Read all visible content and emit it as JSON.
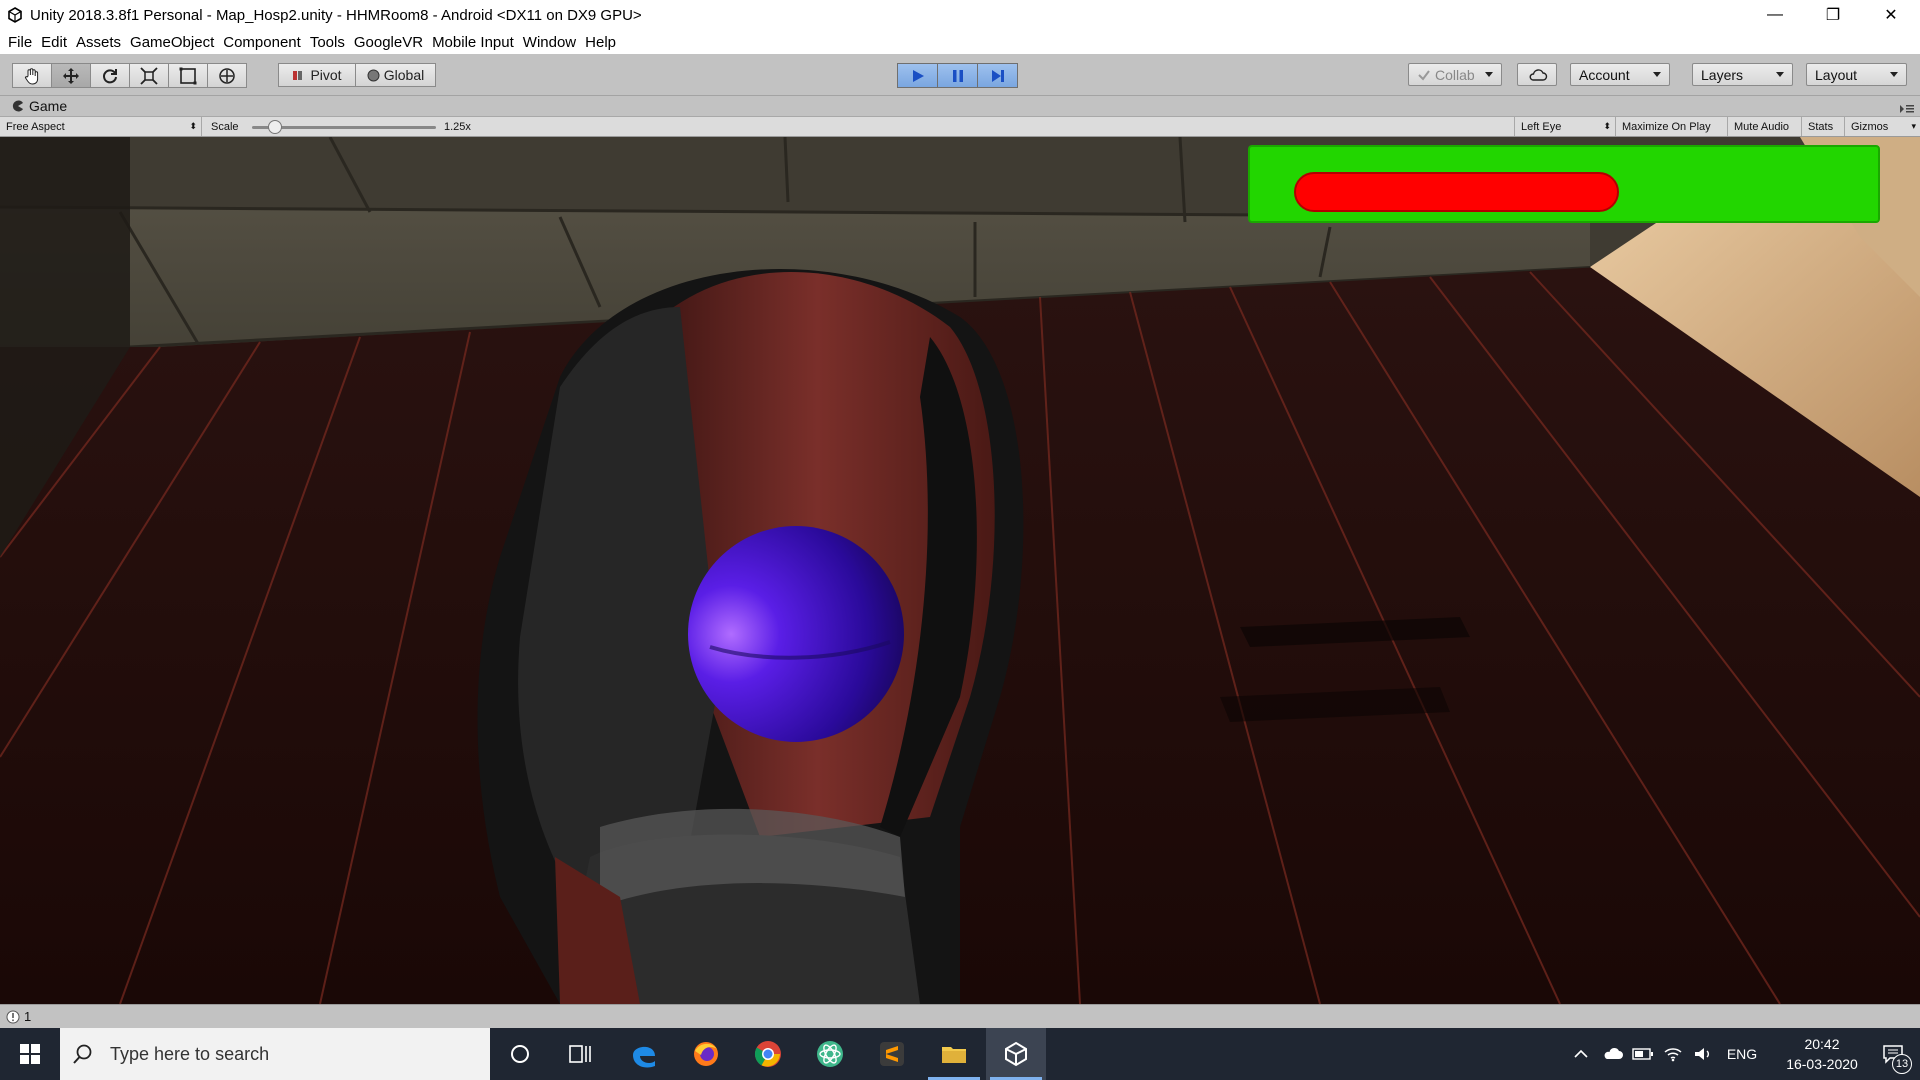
{
  "window": {
    "title": "Unity 2018.3.8f1 Personal - Map_Hosp2.unity - HHMRoom8 - Android <DX11 on DX9 GPU>",
    "minimize": "—",
    "restore": "❐",
    "close": "✕"
  },
  "menu": [
    "File",
    "Edit",
    "Assets",
    "GameObject",
    "Component",
    "Tools",
    "GoogleVR",
    "Mobile Input",
    "Window",
    "Help"
  ],
  "toolbar": {
    "pivot": "Pivot",
    "global": "Global",
    "collab": "Collab",
    "account": "Account",
    "layers": "Layers",
    "layout": "Layout"
  },
  "game_panel": {
    "tab": "Game",
    "aspect": "Free Aspect",
    "scale_label": "Scale",
    "scale_value": "1.25x",
    "eye": "Left Eye",
    "maximize": "Maximize On Play",
    "mute": "Mute Audio",
    "stats": "Stats",
    "gizmos": "Gizmos"
  },
  "hud": {
    "health_fraction": 0.72,
    "bar_color": "#ff0000",
    "frame_color": "#22d600"
  },
  "status": {
    "warning_count": "1"
  },
  "taskbar": {
    "search_placeholder": "Type here to search",
    "lang": "ENG",
    "time": "20:42",
    "date": "16-03-2020",
    "notifications": "13"
  },
  "colors": {
    "accent": "#3a78d8",
    "editor_bg": "#c2c2c2"
  }
}
